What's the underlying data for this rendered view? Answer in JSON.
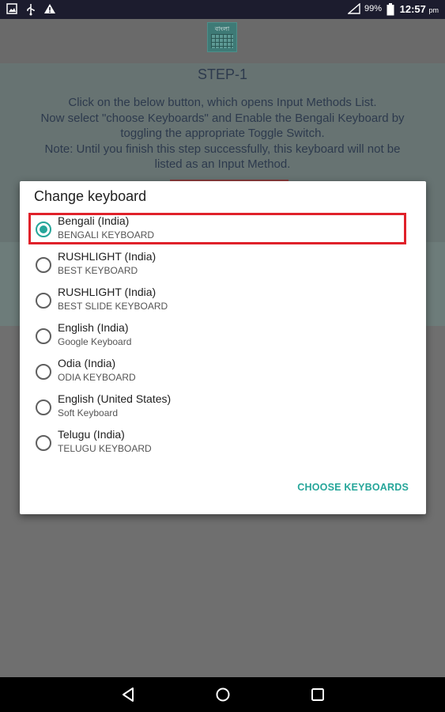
{
  "status_bar": {
    "battery": "99%",
    "time": "12:57",
    "time_suffix": "pm"
  },
  "background": {
    "step_title": "STEP-1",
    "instructions": [
      "Click on the below button, which opens Input Methods List.",
      "Now select \"choose Keyboards\" and Enable the Bengali Keyboard by",
      "toggling the appropriate Toggle Switch.",
      "Note: Until you finish this step successfully, this keyboard will not be",
      "listed as an Input Method."
    ],
    "logo_text": "বাংলা"
  },
  "dialog": {
    "title": "Change keyboard",
    "options": [
      {
        "name": "Bengali (India)",
        "sub": "BENGALI KEYBOARD",
        "checked": true
      },
      {
        "name": "RUSHLIGHT (India)",
        "sub": "BEST KEYBOARD",
        "checked": false
      },
      {
        "name": "RUSHLIGHT (India)",
        "sub": "BEST SLIDE KEYBOARD",
        "checked": false
      },
      {
        "name": "English (India)",
        "sub": "Google Keyboard",
        "checked": false
      },
      {
        "name": "Odia (India)",
        "sub": "ODIA KEYBOARD",
        "checked": false
      },
      {
        "name": "English (United States)",
        "sub": "Soft Keyboard",
        "checked": false
      },
      {
        "name": "Telugu (India)",
        "sub": "TELUGU KEYBOARD",
        "checked": false
      }
    ],
    "choose_button": "CHOOSE KEYBOARDS"
  },
  "colors": {
    "accent": "#26a69a",
    "highlight": "#e0212a"
  },
  "icons": [
    "image-icon",
    "usb-icon",
    "warning-icon",
    "signal-icon",
    "battery-icon",
    "back-icon",
    "home-icon",
    "recents-icon"
  ]
}
